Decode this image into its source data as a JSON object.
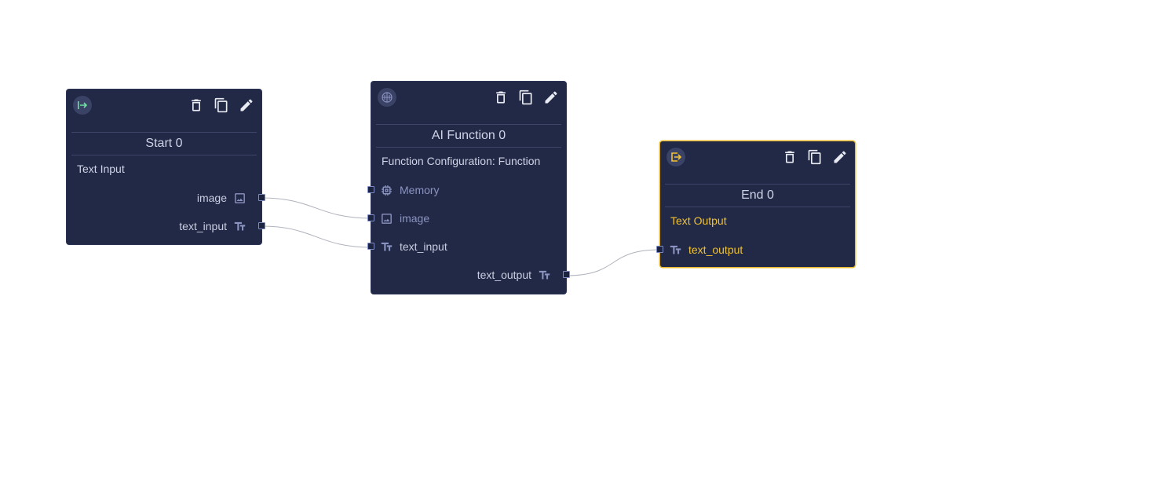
{
  "colors": {
    "node_bg": "#222946",
    "text": "#c9cde0",
    "muted_text": "#8b93c0",
    "accent_yellow": "#f1c232",
    "start_icon": "#6fe0a0",
    "edge": "#b0b3bb"
  },
  "nodes": {
    "start": {
      "icon": "entry-arrow-icon",
      "title": "Start 0",
      "description": "Text Input",
      "outputs": [
        {
          "label": "image",
          "icon": "image-icon"
        },
        {
          "label": "text_input",
          "icon": "text-type-icon"
        }
      ]
    },
    "ai_function": {
      "icon": "brain-icon",
      "title": "AI Function 0",
      "description": "Function Configuration: Function",
      "inputs": [
        {
          "label": "Memory",
          "icon": "chip-icon"
        },
        {
          "label": "image",
          "icon": "image-icon"
        },
        {
          "label": "text_input",
          "icon": "text-type-icon"
        }
      ],
      "outputs": [
        {
          "label": "text_output",
          "icon": "text-type-icon"
        }
      ]
    },
    "end": {
      "icon": "exit-icon",
      "title": "End 0",
      "description": "Text Output",
      "inputs": [
        {
          "label": "text_output",
          "icon": "text-type-icon"
        }
      ]
    }
  },
  "actions": {
    "delete": "trash-icon",
    "duplicate": "copy-icon",
    "edit": "pencil-icon"
  },
  "edges": [
    {
      "from": "Start 0.image",
      "to": "AI Function 0.image"
    },
    {
      "from": "Start 0.text_input",
      "to": "AI Function 0.text_input"
    },
    {
      "from": "AI Function 0.text_output",
      "to": "End 0.text_output"
    }
  ]
}
